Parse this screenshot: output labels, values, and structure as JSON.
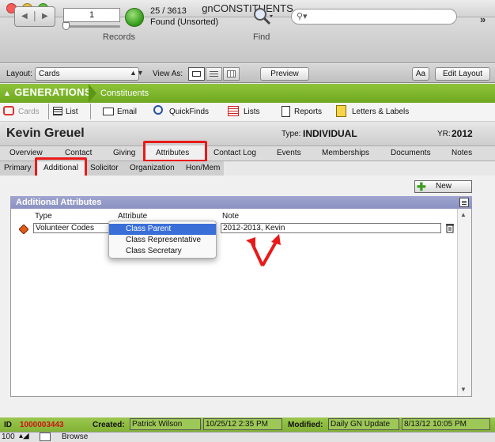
{
  "window": {
    "title": "gnCONSTITUENTS"
  },
  "toolbar": {
    "record_number": "1",
    "record_count": "25 / 3613",
    "found_status": "Found (Unsorted)",
    "records_label": "Records",
    "find_label": "Find",
    "search_placeholder": ""
  },
  "layoutbar": {
    "layout_label": "Layout:",
    "layout_value": "Cards",
    "view_as_label": "View As:",
    "preview_label": "Preview",
    "aa_label": "Aa",
    "edit_layout_label": "Edit Layout"
  },
  "banner": {
    "brand": "GENERATIONS",
    "section": "Constituents"
  },
  "nav": [
    {
      "label": "Cards",
      "icon": "cards-icon"
    },
    {
      "label": "List",
      "icon": "list-icon"
    },
    {
      "label": "Email",
      "icon": "email-icon"
    },
    {
      "label": "QuickFinds",
      "icon": "magnifier-icon"
    },
    {
      "label": "Lists",
      "icon": "lists-icon"
    },
    {
      "label": "Reports",
      "icon": "reports-icon"
    },
    {
      "label": "Letters & Labels",
      "icon": "letters-icon"
    }
  ],
  "record": {
    "name": "Kevin Greuel",
    "type_label": "Type:",
    "type_value": "INDIVIDUAL",
    "yr_label": "YR:",
    "yr_value": "2012"
  },
  "tabs": [
    "Overview",
    "Contact",
    "Giving",
    "Attributes",
    "Contact Log",
    "Events",
    "Memberships",
    "Documents",
    "Notes"
  ],
  "subtabs": [
    "Primary",
    "Additional",
    "Solicitor",
    "Organization",
    "Hon/Mem"
  ],
  "panel": {
    "title": "Additional Attributes",
    "new_label": "New",
    "col_type": "Type",
    "col_attribute": "Attribute",
    "col_note": "Note",
    "row": {
      "type": "Volunteer Codes",
      "note": "2012-2013, Kevin"
    }
  },
  "dropdown": {
    "options": [
      "Class Parent",
      "Class Representative",
      "Class Secretary"
    ],
    "selected": "Class Parent"
  },
  "footer": {
    "id_label": "ID",
    "id_value": "1000003443",
    "created_label": "Created:",
    "created_by": "Patrick Wilson",
    "created_at": "10/25/12 2:35 PM",
    "modified_label": "Modified:",
    "modified_by": "Daily GN Update",
    "modified_at": "8/13/12 10:05 PM"
  },
  "statusbar": {
    "zoom": "100",
    "mode": "Browse"
  },
  "colors": {
    "banner_green": "#7ab52b",
    "panel_header": "#959bc9",
    "highlight_red": "#e81a1a",
    "id_red": "#c81414",
    "selection_blue": "#3a6fd8"
  }
}
